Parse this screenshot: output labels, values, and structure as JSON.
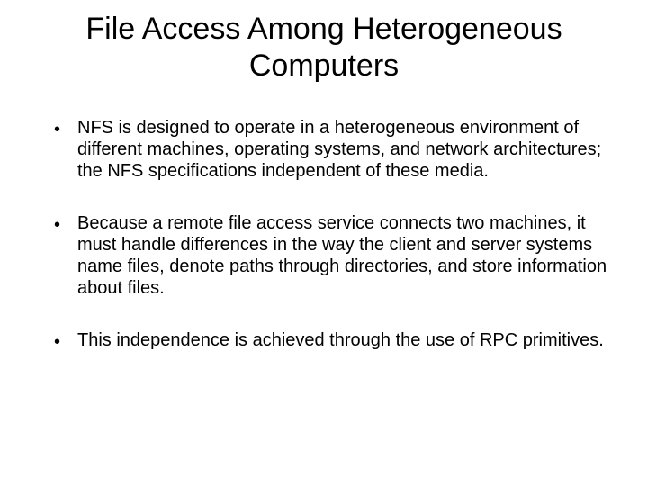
{
  "title": "File Access Among Heterogeneous Computers",
  "bullets": [
    "NFS is designed to operate in a heterogeneous environment of different machines, operating systems, and network architectures; the NFS specifications independent of these media.",
    "Because a remote file access service connects two machines, it must handle differences in the way the client and server systems name files, denote paths through directories, and store information about files.",
    "This independence is achieved through the use of RPC primitives."
  ]
}
